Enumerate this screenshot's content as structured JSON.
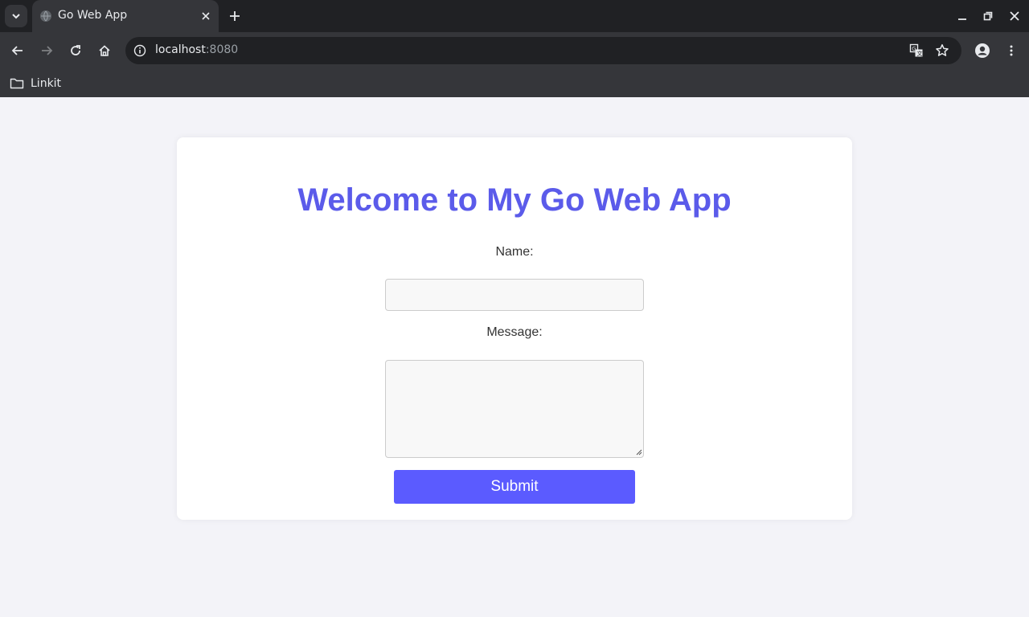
{
  "browser": {
    "tab_title": "Go Web App",
    "url_host": "localhost",
    "url_port": ":8080",
    "bookmarks": [
      {
        "label": "Linkit",
        "icon": "folder-icon"
      }
    ]
  },
  "page": {
    "heading": "Welcome to My Go Web App",
    "form": {
      "name_label": "Name:",
      "name_value": "",
      "message_label": "Message:",
      "message_value": "",
      "submit_label": "Submit"
    }
  },
  "colors": {
    "accent": "#5b5bff",
    "heading": "#5b5bea",
    "page_background": "#f3f3f8",
    "chrome_dark": "#202124",
    "chrome_mid": "#35363a"
  }
}
